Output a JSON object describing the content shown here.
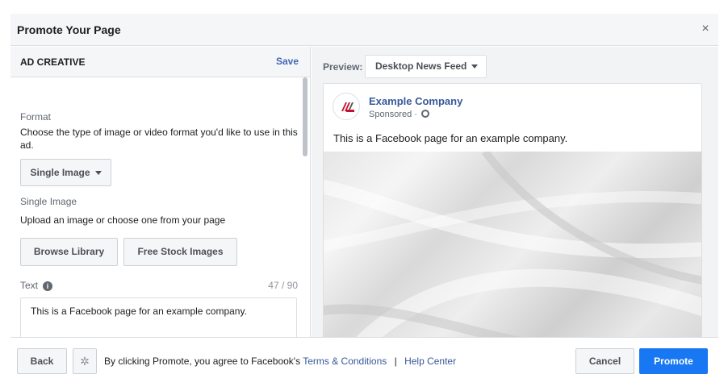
{
  "dialog": {
    "title": "Promote Your Page",
    "close_glyph": "×"
  },
  "ad_creative": {
    "section_title": "AD CREATIVE",
    "save_label": "Save",
    "format_label": "Format",
    "format_description": "Choose the type of image or video format you'd like to use in this ad.",
    "format_dropdown": "Single Image",
    "single_image_label": "Single Image",
    "single_image_description": "Upload an image or choose one from your page",
    "browse_library_label": "Browse Library",
    "free_stock_images_label": "Free Stock Images",
    "text_label": "Text",
    "text_counter": "47 / 90",
    "text_value": "This is a Facebook page for an example company."
  },
  "preview": {
    "label": "Preview:",
    "placement": "Desktop News Feed",
    "company_name": "Example Company",
    "sponsored_label": "Sponsored ·",
    "post_text": "This is a Facebook page for an example company."
  },
  "footer": {
    "back_label": "Back",
    "agree_text": "By clicking Promote, you agree to Facebook's",
    "terms_link": "Terms & Conditions",
    "separator": "|",
    "help_link": "Help Center",
    "cancel_label": "Cancel",
    "promote_label": "Promote"
  },
  "icons": {
    "close": "close-icon",
    "caret": "caret-down-icon",
    "info": "info-icon",
    "globe": "globe-icon",
    "gear": "gear-icon"
  },
  "colors": {
    "link": "#385898",
    "save": "#4267b2",
    "primary_button": "#1877f2",
    "logo_red": "#c8102e"
  }
}
